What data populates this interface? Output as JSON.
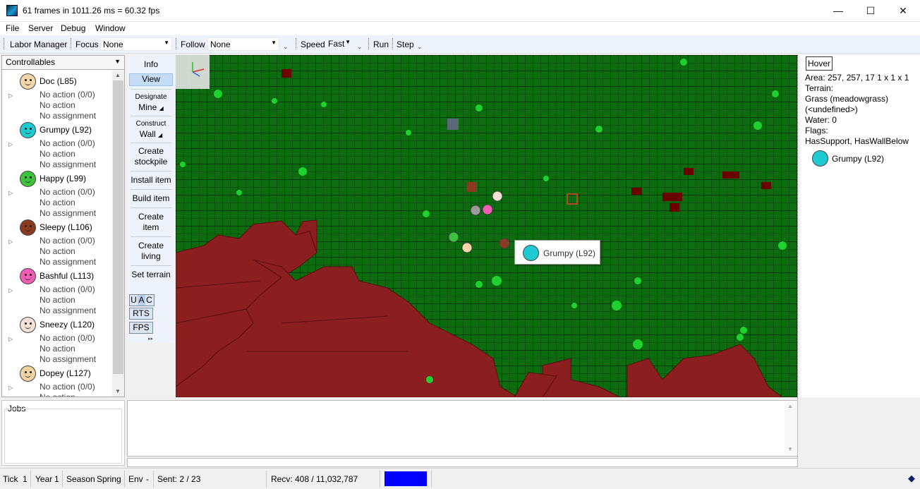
{
  "window": {
    "title": "61 frames in 1011.26 ms = 60.32 fps",
    "minimize": "—",
    "maximize": "☐",
    "close": "✕"
  },
  "menu": [
    "File",
    "Server",
    "Debug",
    "Window"
  ],
  "toolbar": {
    "labor_manager": "Labor Manager",
    "focus_label": "Focus",
    "focus_value": "None",
    "follow_label": "Follow",
    "follow_value": "None",
    "speed_label": "Speed",
    "speed_value": "Fast",
    "run": "Run",
    "step": "Step"
  },
  "controllables": {
    "header": "Controllables",
    "characters": [
      {
        "name": "Doc (L85)",
        "color": "#f5d6a8",
        "action": "No action (0/0)",
        "line2": "No action",
        "assignment": "No assignment"
      },
      {
        "name": "Grumpy (L92)",
        "color": "#1fc9d2",
        "action": "No action (0/0)",
        "line2": "No action",
        "assignment": "No assignment"
      },
      {
        "name": "Happy (L99)",
        "color": "#3cc33c",
        "action": "No action (0/0)",
        "line2": "No action",
        "assignment": "No assignment"
      },
      {
        "name": "Sleepy (L106)",
        "color": "#8a3a1e",
        "action": "No action (0/0)",
        "line2": "No action",
        "assignment": "No assignment"
      },
      {
        "name": "Bashful (L113)",
        "color": "#f25cb4",
        "action": "No action (0/0)",
        "line2": "No action",
        "assignment": "No assignment"
      },
      {
        "name": "Sneezy (L120)",
        "color": "#f6e0d6",
        "action": "No action (0/0)",
        "line2": "No action",
        "assignment": "No assignment"
      },
      {
        "name": "Dopey (L127)",
        "color": "#f3d2a2",
        "action": "No action (0/0)",
        "line2": "No action",
        "assignment": ""
      }
    ]
  },
  "tools": {
    "info": "Info",
    "view": "View",
    "designate_label": "Designate",
    "designate_value": "Mine",
    "construct_label": "Construct",
    "construct_value": "Wall",
    "create_stockpile_1": "Create",
    "create_stockpile_2": "stockpile",
    "install_item": "Install item",
    "build_item": "Build item",
    "create_item_1": "Create",
    "create_item_2": "item",
    "create_living_1": "Create",
    "create_living_2": "living",
    "set_terrain": "Set terrain",
    "uac": [
      "U",
      "A",
      "C"
    ],
    "rts": "RTS",
    "fps": "FPS"
  },
  "viewport": {
    "tooltip": "Grumpy (L92)"
  },
  "hover": {
    "button": "Hover",
    "area": "Area:  257, 257, 17  1 x 1 x 1",
    "terrain_label": "Terrain:",
    "terrain_value": "Grass (meadowgrass)",
    "terrain_extra": "(<undefined>)",
    "water": "Water:  0",
    "flags_label": "Flags:",
    "flags_value": "HasSupport, HasWallBelow",
    "object": "Grumpy (L92)"
  },
  "jobs": {
    "label": "Jobs"
  },
  "status": {
    "tick_label": "Tick",
    "tick_value": "1",
    "year_label": "Year",
    "year_value": "1",
    "season_label": "Season",
    "season_value": "Spring",
    "env_label": "Env",
    "env_value": "-",
    "sent": "Sent: 2 / 23",
    "recv": "Recv: 408 / 11,032,787",
    "indicator_color": "#0000ff"
  },
  "colors": {
    "grass": "#0d6b10",
    "rock": "#8b1e1e",
    "accent_select": "#c4dcf5"
  }
}
